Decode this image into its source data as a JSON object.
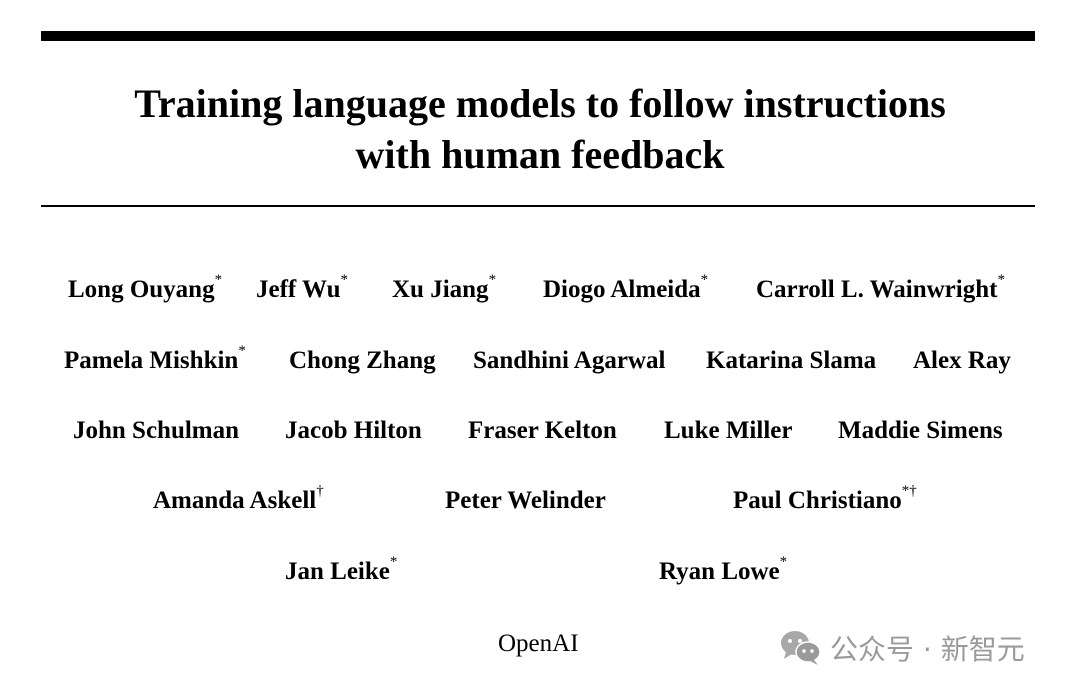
{
  "paper": {
    "title_line1": "Training language models to follow instructions",
    "title_line2": "with human feedback",
    "author_rows": [
      [
        {
          "name": "Long Ouyang",
          "mark": "*"
        },
        {
          "name": "Jeff Wu",
          "mark": "*"
        },
        {
          "name": "Xu Jiang",
          "mark": "*"
        },
        {
          "name": "Diogo Almeida",
          "mark": "*"
        },
        {
          "name": "Carroll L. Wainwright",
          "mark": "*"
        }
      ],
      [
        {
          "name": "Pamela Mishkin",
          "mark": "*"
        },
        {
          "name": "Chong Zhang",
          "mark": ""
        },
        {
          "name": "Sandhini Agarwal",
          "mark": ""
        },
        {
          "name": "Katarina Slama",
          "mark": ""
        },
        {
          "name": "Alex Ray",
          "mark": ""
        }
      ],
      [
        {
          "name": "John Schulman",
          "mark": ""
        },
        {
          "name": "Jacob Hilton",
          "mark": ""
        },
        {
          "name": "Fraser Kelton",
          "mark": ""
        },
        {
          "name": "Luke Miller",
          "mark": ""
        },
        {
          "name": "Maddie Simens",
          "mark": ""
        }
      ],
      [
        {
          "name": "Amanda Askell",
          "mark": "†"
        },
        {
          "name": "Peter Welinder",
          "mark": ""
        },
        {
          "name": "Paul Christiano",
          "mark": "*†"
        }
      ],
      [
        {
          "name": "Jan Leike",
          "mark": "*"
        },
        {
          "name": "Ryan Lowe",
          "mark": "*"
        }
      ]
    ],
    "affiliation": "OpenAI"
  },
  "watermark": {
    "icon": "wechat-icon",
    "text": "公众号 · 新智元",
    "color": "#9a9a9a"
  }
}
